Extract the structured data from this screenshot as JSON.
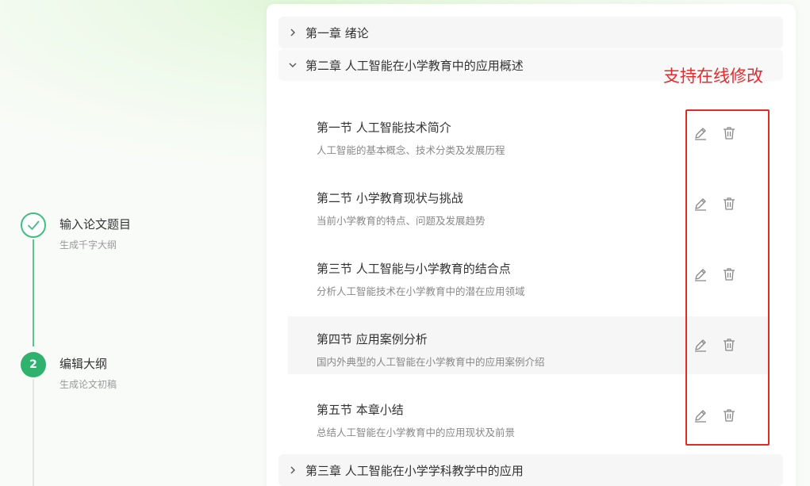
{
  "steps": [
    {
      "title": "输入论文题目",
      "subtitle": "生成千字大纲",
      "state": "done",
      "icon": "check-icon"
    },
    {
      "title": "编辑大纲",
      "subtitle": "生成论文初稿",
      "state": "active",
      "number": "2"
    }
  ],
  "outline": {
    "chapters": [
      {
        "label": "第一章 绪论",
        "expanded": false
      },
      {
        "label": "第二章 人工智能在小学教育中的应用概述",
        "expanded": true
      },
      {
        "label": "第三章 人工智能在小学学科教学中的应用",
        "expanded": false
      }
    ],
    "sections": [
      {
        "title": "第一节 人工智能技术简介",
        "desc": "人工智能的基本概念、技术分类及发展历程"
      },
      {
        "title": "第二节 小学教育现状与挑战",
        "desc": "当前小学教育的特点、问题及发展趋势"
      },
      {
        "title": "第三节 人工智能与小学教育的结合点",
        "desc": "分析人工智能技术在小学教育中的潜在应用领域"
      },
      {
        "title": "第四节 应用案例分析",
        "desc": "国内外典型的人工智能在小学教育中的应用案例介绍"
      },
      {
        "title": "第五节 本章小结",
        "desc": "总结人工智能在小学教育中的应用现状及前景"
      }
    ],
    "highlighted_section": 3
  },
  "annotation": {
    "text": "支持在线修改",
    "color": "#e62b2b"
  },
  "icons": {
    "edit": "pencil-icon",
    "delete": "trash-icon"
  },
  "colors": {
    "accent": "#2fb26e",
    "highlight_box": "#e22a2a"
  }
}
